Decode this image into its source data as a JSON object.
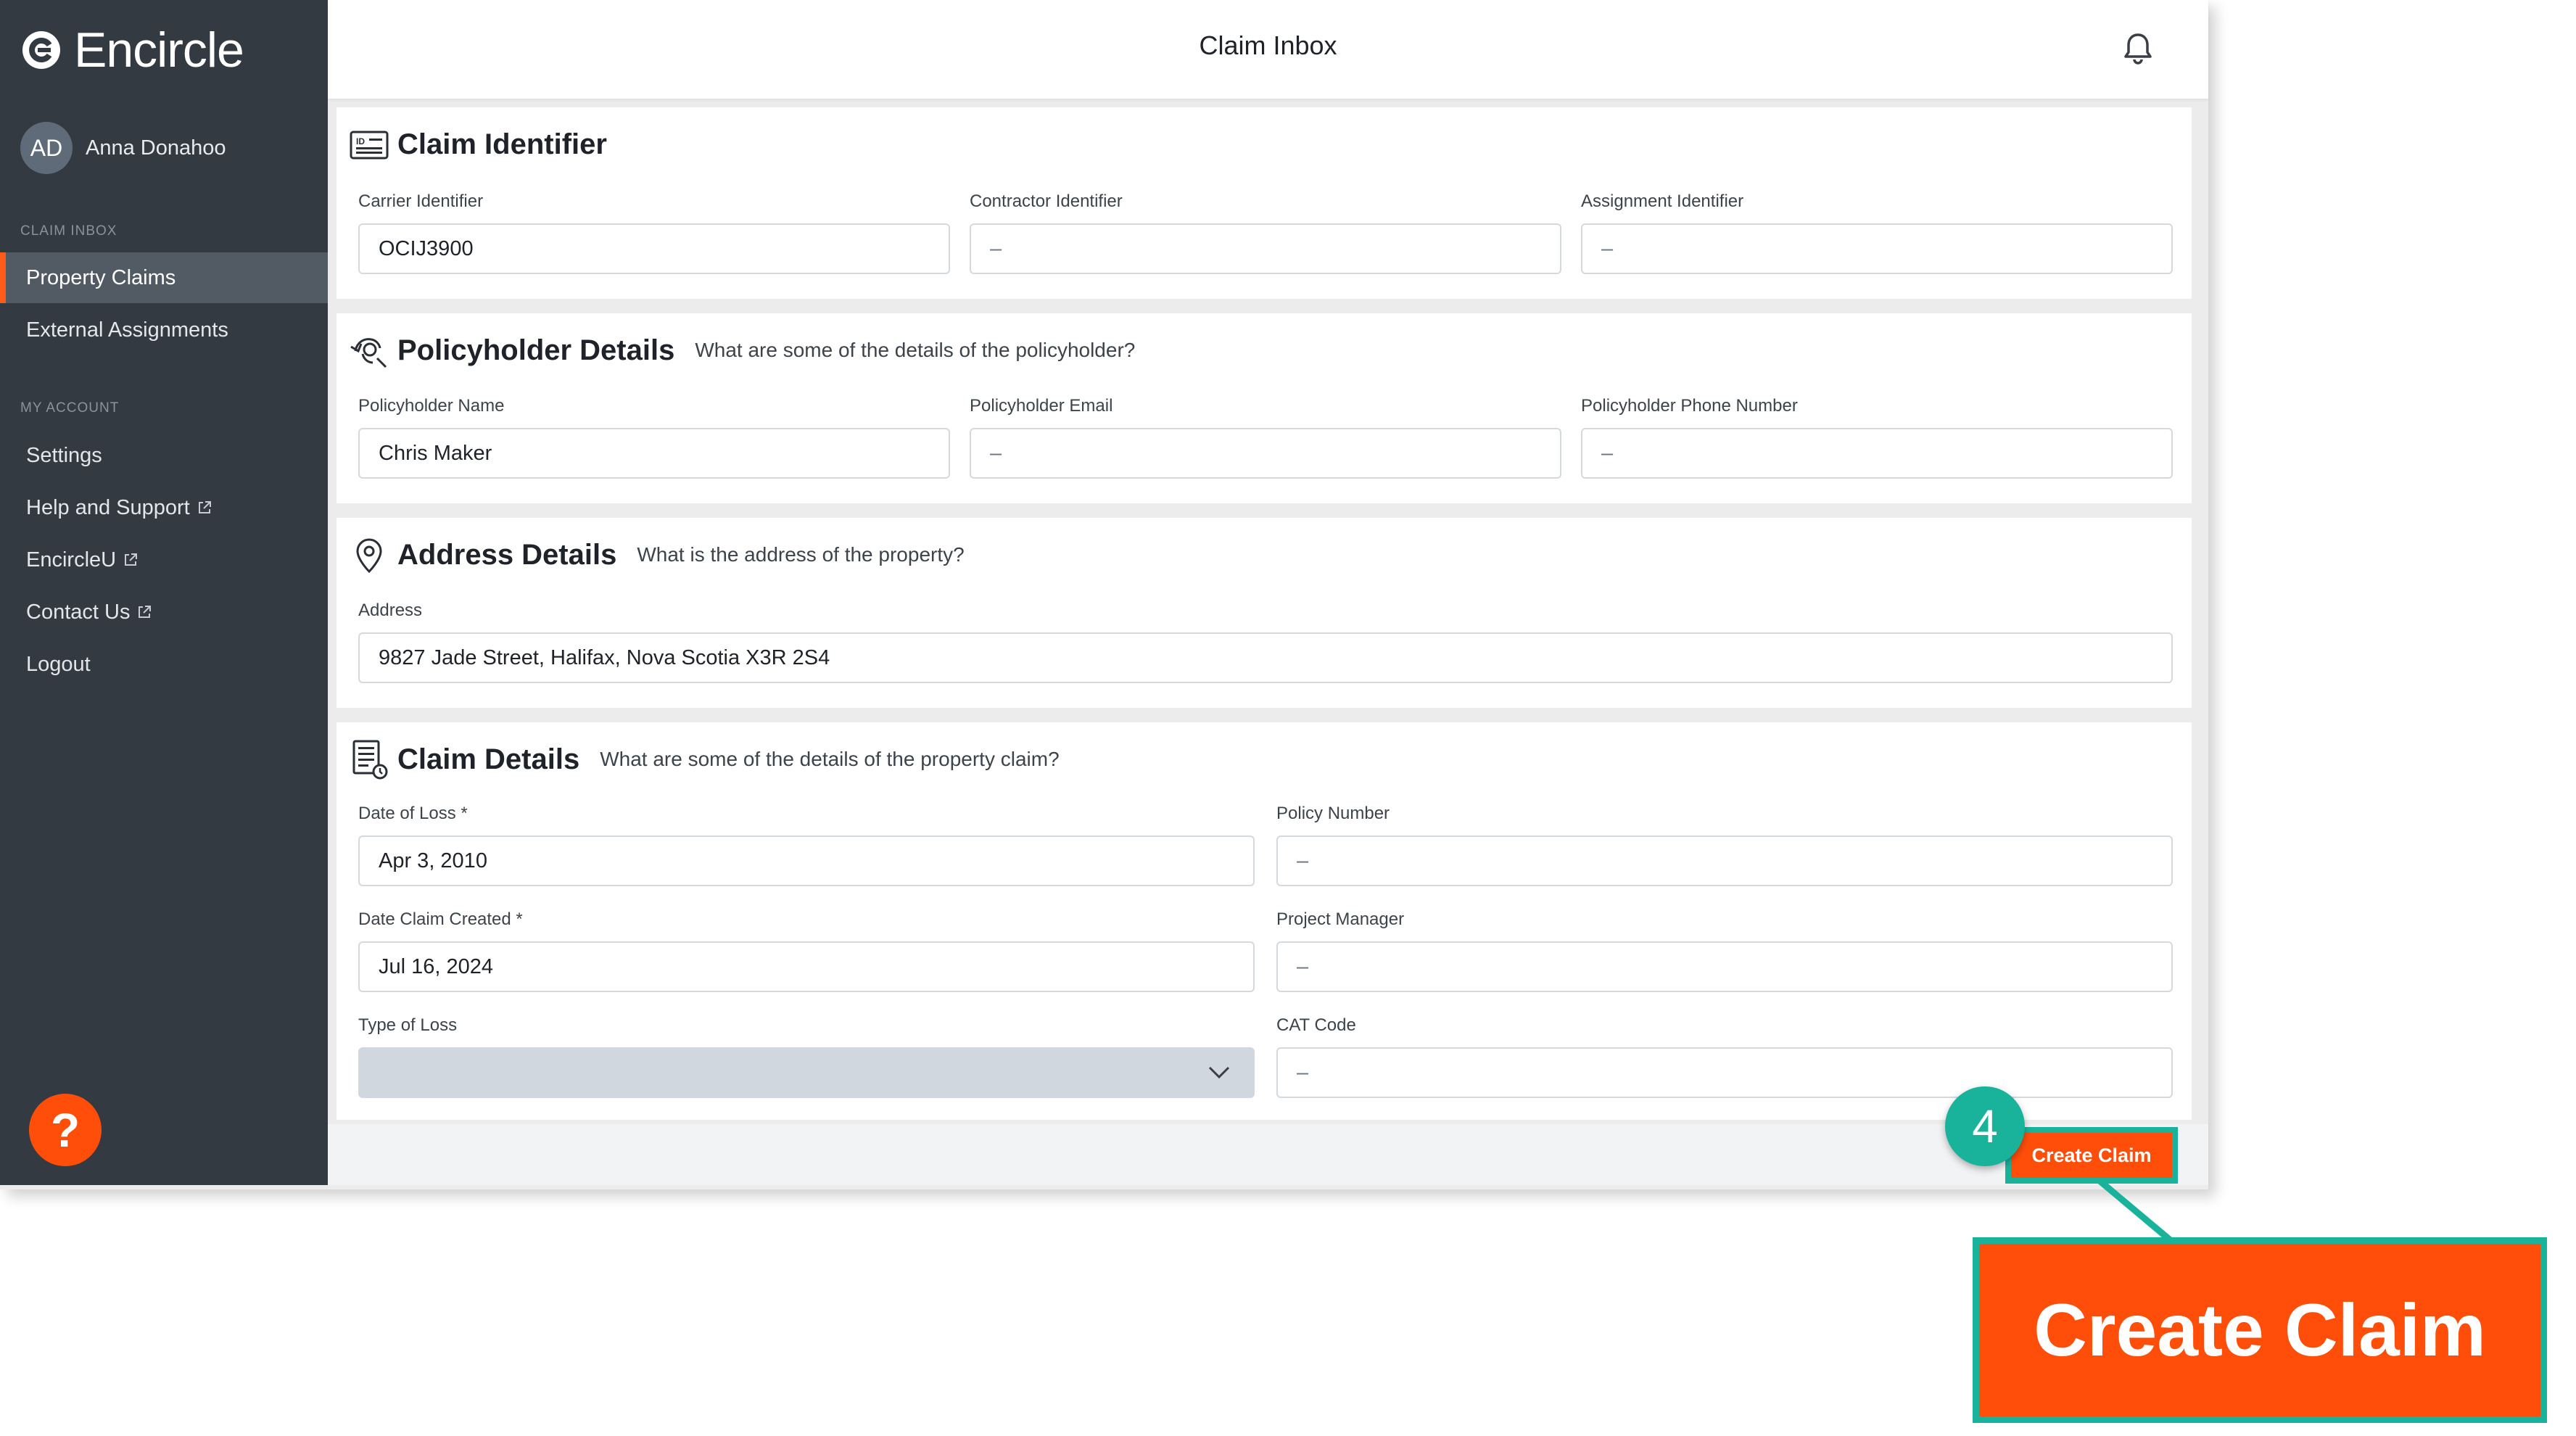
{
  "app": {
    "brand": "Encircle",
    "user": {
      "initials": "AD",
      "name": "Anna Donahoo"
    },
    "sidebar": {
      "section_claim_inbox": "CLAIM INBOX",
      "section_my_account": "MY ACCOUNT",
      "items": [
        {
          "label": "Property Claims",
          "active": true
        },
        {
          "label": "External Assignments"
        },
        {
          "label": "Settings"
        },
        {
          "label": "Help and Support",
          "external": true
        },
        {
          "label": "EncircleU",
          "external": true
        },
        {
          "label": "Contact Us",
          "external": true
        },
        {
          "label": "Logout"
        }
      ],
      "help_button": "?"
    },
    "header": {
      "title": "Claim Inbox"
    }
  },
  "claim_identifier": {
    "title": "Claim Identifier",
    "carrier": {
      "label": "Carrier Identifier",
      "value": "OCIJ3900"
    },
    "contractor": {
      "label": "Contractor Identifier",
      "value": "–"
    },
    "assignment": {
      "label": "Assignment Identifier",
      "value": "–"
    }
  },
  "policyholder": {
    "title": "Policyholder Details",
    "subtitle": "What are some of the details of the policyholder?",
    "name": {
      "label": "Policyholder Name",
      "value": "Chris Maker"
    },
    "email": {
      "label": "Policyholder Email",
      "value": "–"
    },
    "phone": {
      "label": "Policyholder Phone Number",
      "value": "–"
    }
  },
  "address": {
    "title": "Address Details",
    "subtitle": "What is the address of the property?",
    "field": {
      "label": "Address",
      "value": "9827 Jade Street, Halifax, Nova Scotia X3R 2S4"
    }
  },
  "claim_details": {
    "title": "Claim Details",
    "subtitle": "What are some of the details of the property claim?",
    "date_of_loss": {
      "label": "Date of Loss *",
      "value": "Apr 3, 2010"
    },
    "policy_number": {
      "label": "Policy Number",
      "value": "–"
    },
    "date_created": {
      "label": "Date Claim Created *",
      "value": "Jul 16, 2024"
    },
    "project_manager": {
      "label": "Project Manager",
      "value": "–"
    },
    "type_of_loss": {
      "label": "Type of Loss",
      "value": ""
    },
    "cat_code": {
      "label": "CAT Code",
      "value": "–"
    }
  },
  "actions": {
    "create_claim": "Create Claim"
  },
  "annotation": {
    "step": "4",
    "zoom_label": "Create Claim"
  },
  "colors": {
    "accent": "#ff4e0a",
    "sidebar": "#343a42",
    "highlight": "#19b39b"
  }
}
